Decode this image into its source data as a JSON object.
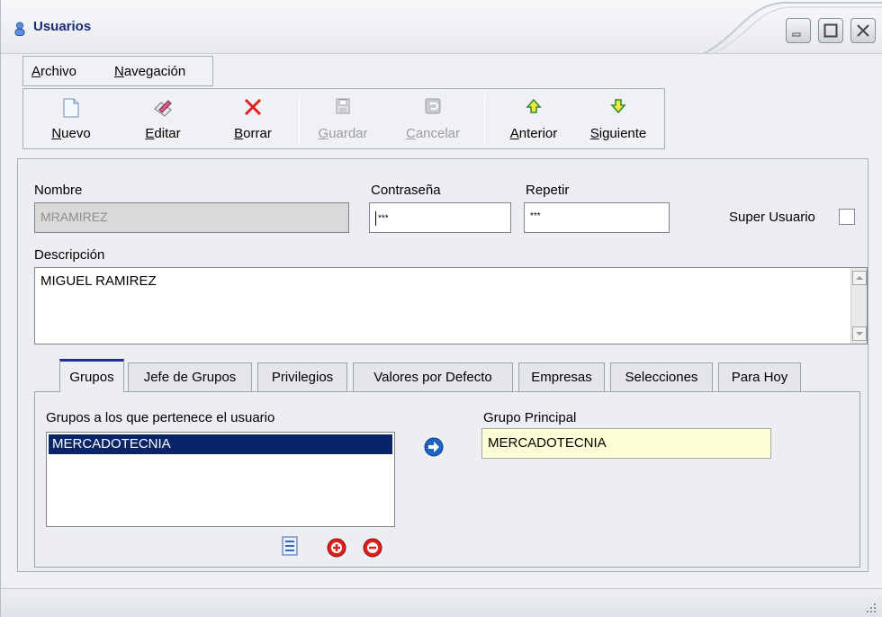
{
  "window": {
    "title": "Usuarios"
  },
  "menu": {
    "items": [
      {
        "label": "Archivo",
        "underline": "A",
        "rest": "rchivo"
      },
      {
        "label": "Navegación",
        "underline": "N",
        "rest": "avegación"
      }
    ]
  },
  "toolbar": {
    "buttons": [
      {
        "first": "N",
        "rest": "uevo",
        "icon": "new-document-icon"
      },
      {
        "first": "E",
        "rest": "ditar",
        "icon": "edit-pencil-icon"
      },
      {
        "first": "B",
        "rest": "orrar",
        "icon": "delete-x-icon"
      },
      {
        "first": "G",
        "rest": "uardar",
        "icon": "save-disk-icon",
        "enabled": false
      },
      {
        "first": "C",
        "rest": "ancelar",
        "icon": "cancel-undo-icon",
        "enabled": false
      },
      {
        "first": "A",
        "rest": "nterior",
        "icon": "arrow-up-icon"
      },
      {
        "first": "S",
        "rest": "iguiente",
        "icon": "arrow-down-icon"
      }
    ]
  },
  "form": {
    "nombre_label": "Nombre",
    "nombre_value": "MRAMIREZ",
    "contrasena_label": "Contraseña",
    "contrasena_value": "***",
    "repetir_label": "Repetir",
    "repetir_value": "***",
    "super_usuario_label": "Super Usuario",
    "super_usuario_checked": false,
    "descripcion_label": "Descripción",
    "descripcion_value": "MIGUEL RAMIREZ"
  },
  "tabs": [
    {
      "label": "Grupos",
      "active": true
    },
    {
      "label": "Jefe de Grupos"
    },
    {
      "label": "Privilegios"
    },
    {
      "label": "Valores por Defecto"
    },
    {
      "label": "Empresas"
    },
    {
      "label": "Selecciones"
    },
    {
      "label": "Para Hoy"
    }
  ],
  "grupos": {
    "list_label": "Grupos a los que pertenece el usuario",
    "items": [
      "MERCADOTECNIA"
    ],
    "principal_label": "Grupo Principal",
    "principal_value": "MERCADOTECNIA"
  },
  "colors": {
    "title_text": "#1a2a7a",
    "selection": "#0a246a",
    "active_tab_border": "#1e2f8c",
    "principal_field": "#fefed6",
    "add_remove": "#e0201c",
    "assign_arrow": "#1d64c8"
  }
}
